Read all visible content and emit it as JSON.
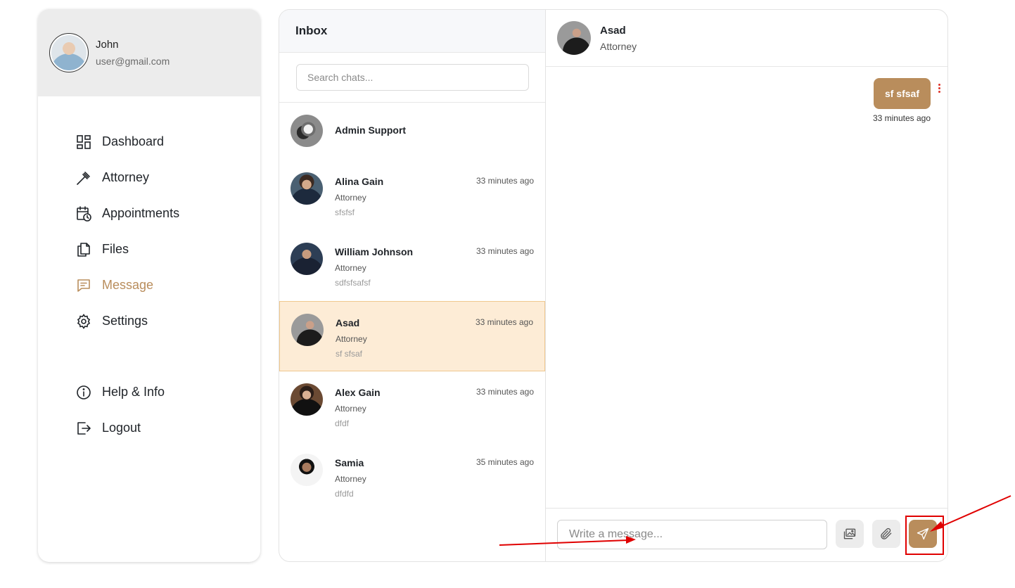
{
  "user": {
    "name": "John",
    "email": "user@gmail.com"
  },
  "nav": {
    "dashboard": "Dashboard",
    "attorney": "Attorney",
    "appointments": "Appointments",
    "files": "Files",
    "message": "Message",
    "settings": "Settings",
    "help": "Help & Info",
    "logout": "Logout"
  },
  "inbox": {
    "title": "Inbox",
    "search_placeholder": "Search chats...",
    "chats": [
      {
        "name": "Admin Support",
        "role": "",
        "preview": "",
        "time": ""
      },
      {
        "name": "Alina Gain",
        "role": "Attorney",
        "preview": "sfsfsf",
        "time": "33 minutes ago"
      },
      {
        "name": "William Johnson",
        "role": "Attorney",
        "preview": "sdfsfsafsf",
        "time": "33 minutes ago"
      },
      {
        "name": "Asad",
        "role": "Attorney",
        "preview": "sf sfsaf",
        "time": "33 minutes ago"
      },
      {
        "name": "Alex Gain",
        "role": "Attorney",
        "preview": "dfdf",
        "time": "33 minutes ago"
      },
      {
        "name": "Samia",
        "role": "Attorney",
        "preview": "dfdfd",
        "time": "35 minutes ago"
      }
    ]
  },
  "conversation": {
    "name": "Asad",
    "role": "Attorney",
    "messages": [
      {
        "text": "sf sfsaf",
        "time": "33 minutes ago"
      }
    ],
    "input_placeholder": "Write a message..."
  },
  "colors": {
    "accent": "#b98d5c",
    "active_row": "#fdecd6",
    "annotation": "#e00000"
  },
  "icons": {
    "nav": [
      "dashboard-icon",
      "gavel-icon",
      "calendar-clock-icon",
      "files-icon",
      "message-icon",
      "gear-icon",
      "info-icon",
      "logout-icon"
    ],
    "composer": [
      "image-icon",
      "paperclip-icon",
      "send-icon"
    ]
  }
}
